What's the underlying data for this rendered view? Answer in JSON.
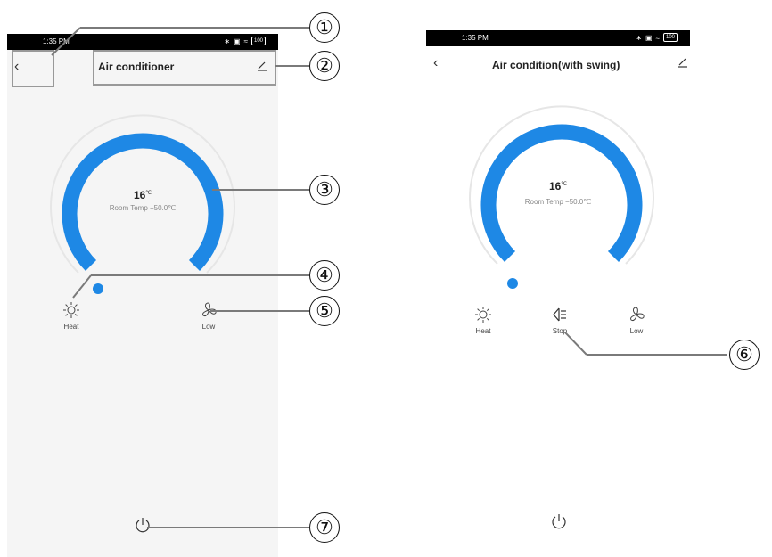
{
  "left": {
    "status_time": "1:35 PM",
    "battery": "100",
    "title": "Air conditioner",
    "temp_value": "16",
    "temp_unit": "℃",
    "room_temp": "Room Temp −50.0℃",
    "controls": [
      {
        "label": "Heat",
        "icon": "sun-icon"
      },
      {
        "label": "Low",
        "icon": "fan-icon"
      }
    ]
  },
  "right": {
    "status_time": "1:35 PM",
    "battery": "100",
    "title": "Air condition(with swing)",
    "temp_value": "16",
    "temp_unit": "℃",
    "room_temp": "Room Temp −50.0℃",
    "controls": [
      {
        "label": "Heat",
        "icon": "sun-icon"
      },
      {
        "label": "Stop",
        "icon": "swing-icon"
      },
      {
        "label": "Low",
        "icon": "fan-icon"
      }
    ]
  },
  "callouts": [
    "①",
    "②",
    "③",
    "④",
    "⑤",
    "⑥",
    "⑦"
  ],
  "colors": {
    "accent": "#1e88e5",
    "track": "#e6e6e6",
    "callout_line": "#7a7a7a"
  }
}
